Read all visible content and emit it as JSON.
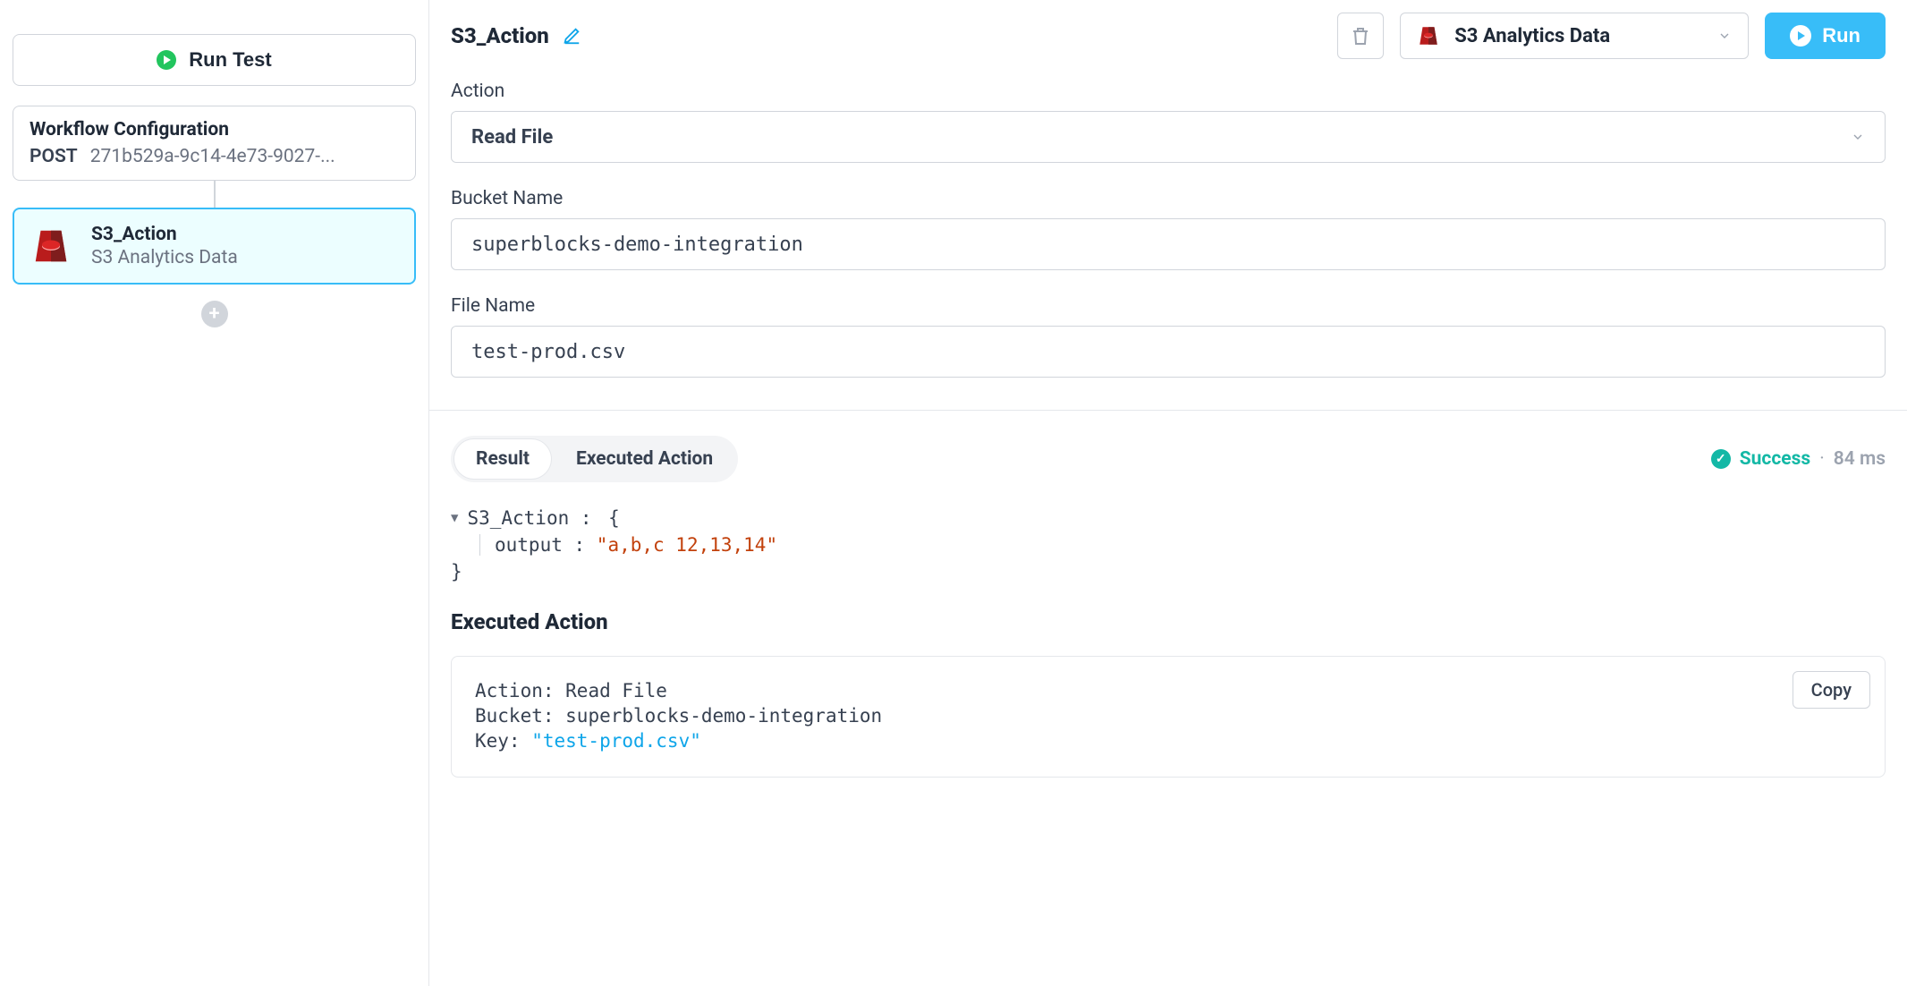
{
  "sidebar": {
    "run_test_label": "Run Test",
    "workflow_card": {
      "title": "Workflow Configuration",
      "method": "POST",
      "endpoint": "271b529a-9c14-4e73-9027-..."
    },
    "step": {
      "name": "S3_Action",
      "sub": "S3 Analytics Data"
    }
  },
  "header": {
    "title": "S3_Action",
    "datasource_label": "S3 Analytics Data",
    "run_label": "Run"
  },
  "form": {
    "action_label": "Action",
    "action_value": "Read File",
    "bucket_label": "Bucket Name",
    "bucket_value": "superblocks-demo-integration",
    "file_label": "File Name",
    "file_value": "test-prod.csv"
  },
  "results": {
    "tabs": {
      "result": "Result",
      "executed": "Executed Action"
    },
    "status_text": "Success",
    "latency": "84 ms",
    "json": {
      "root_key": "S3_Action",
      "output_key": "output",
      "output_value": "\"a,b,c 12,13,14\""
    },
    "executed_title": "Executed Action",
    "executed_card": {
      "copy_label": "Copy",
      "action_line_prefix": "Action: ",
      "action_line_value": "Read File",
      "bucket_line_prefix": "Bucket: ",
      "bucket_line_value": "superblocks-demo-integration",
      "key_line_prefix": "Key: ",
      "key_line_value": "\"test-prod.csv\""
    }
  }
}
